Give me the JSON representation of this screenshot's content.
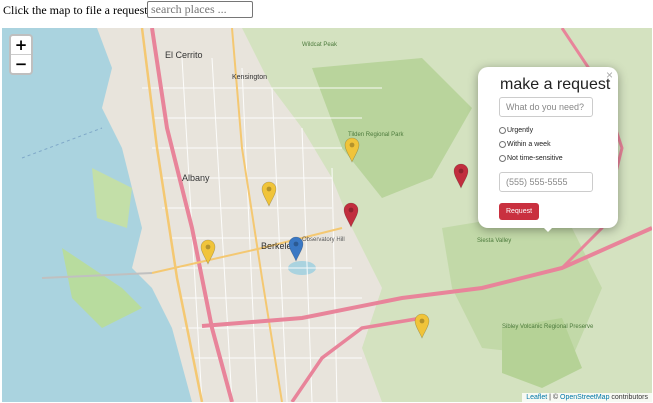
{
  "header": {
    "title": "Click the map to file a request",
    "search_placeholder": "search places ..."
  },
  "map": {
    "zoom_in": "+",
    "zoom_out": "−",
    "place_labels": [
      {
        "name": "El Cerrito"
      },
      {
        "name": "Kensington"
      },
      {
        "name": "Albany"
      },
      {
        "name": "Berkeley"
      },
      {
        "name": "Tilden Regional Park"
      },
      {
        "name": "Observatory Hill"
      },
      {
        "name": "Sibley Volcanic Regional Preserve"
      },
      {
        "name": "Siesta Valley"
      },
      {
        "name": "Wildcat Peak"
      }
    ],
    "markers": [
      {
        "color": "yellow"
      },
      {
        "color": "yellow"
      },
      {
        "color": "yellow"
      },
      {
        "color": "yellow"
      },
      {
        "color": "red"
      },
      {
        "color": "red"
      },
      {
        "color": "blue"
      }
    ]
  },
  "popup": {
    "title": "make a request",
    "close": "×",
    "need_placeholder": "What do you need?",
    "options": [
      "Urgently",
      "Within a week",
      "Not time-sensitive"
    ],
    "phone_placeholder": "(555) 555-5555",
    "submit_label": "Request"
  },
  "attribution": {
    "leaflet": "Leaflet",
    "separator": " | © ",
    "osm": "OpenStreetMap",
    "suffix": " contributors"
  },
  "colors": {
    "water": "#aad3df",
    "park": "#c8dcb0",
    "urban": "#e8e4dc",
    "marker_yellow": "#f0c43a",
    "marker_red": "#c12e3e",
    "marker_blue": "#3a78c4",
    "button": "#c9303f"
  }
}
